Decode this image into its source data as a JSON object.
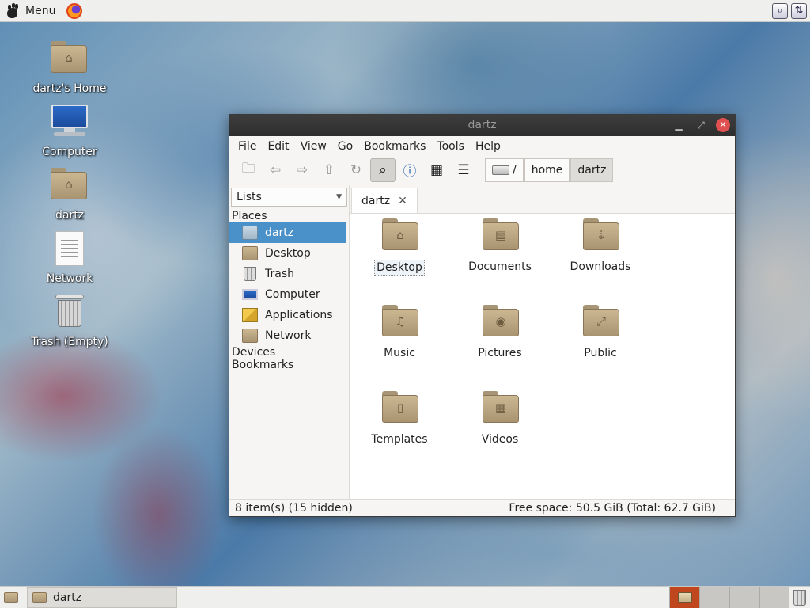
{
  "top_panel": {
    "menu_label": "Menu",
    "icons": [
      "gnome-foot-icon",
      "firefox-icon",
      "search-tray-icon",
      "network-tray-icon"
    ]
  },
  "desktop": {
    "icons": [
      {
        "label": "dartz's Home",
        "icon": "home-folder-icon"
      },
      {
        "label": "Computer",
        "icon": "computer-icon"
      },
      {
        "label": "dartz",
        "icon": "home-folder-icon"
      },
      {
        "label": "Network",
        "icon": "document-icon"
      },
      {
        "label": "Trash (Empty)",
        "icon": "trash-icon"
      }
    ]
  },
  "window": {
    "title": "dartz",
    "menu": {
      "file": "File",
      "edit": "Edit",
      "view": "View",
      "go": "Go",
      "bookmarks": "Bookmarks",
      "tools": "Tools",
      "help": "Help"
    },
    "path": {
      "root": "/",
      "home": "home",
      "current": "dartz"
    },
    "sidebar": {
      "mode": "Lists",
      "places_heading": "Places",
      "places": [
        {
          "label": "dartz",
          "icon": "home-folder-icon",
          "selected": true
        },
        {
          "label": "Desktop",
          "icon": "desktop-folder-icon"
        },
        {
          "label": "Trash",
          "icon": "trash-icon"
        },
        {
          "label": "Computer",
          "icon": "computer-icon"
        },
        {
          "label": "Applications",
          "icon": "applications-icon"
        },
        {
          "label": "Network",
          "icon": "network-folder-icon"
        }
      ],
      "devices_heading": "Devices",
      "bookmarks_heading": "Bookmarks"
    },
    "tab": {
      "label": "dartz",
      "close": "✕"
    },
    "files": [
      {
        "name": "Desktop",
        "glyph": "⌂"
      },
      {
        "name": "Documents",
        "glyph": "▤"
      },
      {
        "name": "Downloads",
        "glyph": "⇣"
      },
      {
        "name": "Music",
        "glyph": "♫"
      },
      {
        "name": "Pictures",
        "glyph": "◉"
      },
      {
        "name": "Public",
        "glyph": "⤢"
      },
      {
        "name": "Templates",
        "glyph": "▯"
      },
      {
        "name": "Videos",
        "glyph": "▦"
      }
    ],
    "status": {
      "items": "8 item(s) (15 hidden)",
      "free_space": "Free space: 50.5 GiB (Total: 62.7 GiB)"
    }
  },
  "taskbar": {
    "task_label": "dartz"
  }
}
